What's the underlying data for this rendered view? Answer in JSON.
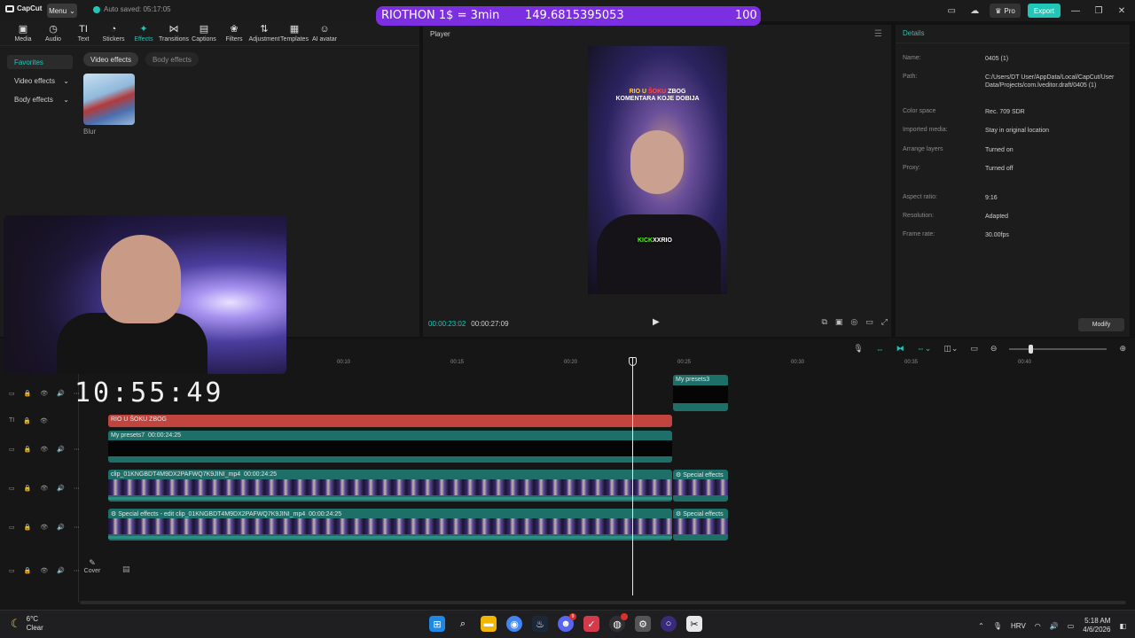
{
  "titlebar": {
    "app_name": "CapCut",
    "menu_label": "Menu",
    "autosave": "Auto saved: 05:17:05",
    "pro_label": "Pro",
    "export_label": "Export"
  },
  "banner": {
    "left": "RIOTHON 1$ = 3min",
    "middle": "149.6815395053",
    "right": "100"
  },
  "toolbar": [
    {
      "label": "Media",
      "icon": "▣"
    },
    {
      "label": "Audio",
      "icon": "◷"
    },
    {
      "label": "Text",
      "icon": "TI"
    },
    {
      "label": "Stickers",
      "icon": "◔"
    },
    {
      "label": "Effects",
      "icon": "✦"
    },
    {
      "label": "Transitions",
      "icon": "⋈"
    },
    {
      "label": "Captions",
      "icon": "▤"
    },
    {
      "label": "Filters",
      "icon": "❀"
    },
    {
      "label": "Adjustment",
      "icon": "⇅"
    },
    {
      "label": "Templates",
      "icon": "▦"
    },
    {
      "label": "AI avatar",
      "icon": "☺"
    }
  ],
  "side_nav": {
    "favorites": "Favorites",
    "video_effects": "Video effects",
    "body_effects": "Body effects"
  },
  "effect_tabs": {
    "video": "Video effects",
    "body": "Body effects"
  },
  "effect_card": {
    "label": "Blur"
  },
  "player": {
    "title": "Player",
    "caption_line1_a": "RIO U",
    "caption_line1_b": "ŠOKU",
    "caption_line1_c": "ZBOG",
    "caption_line2": "KOMENTARA KOJE DOBIJA",
    "kick_a": "KICK",
    "kick_b": "XXRIO",
    "current_time": "00:00:23:02",
    "total_time": "00:00:27:09"
  },
  "details": {
    "title": "Details",
    "rows": [
      {
        "key": "Name:",
        "value": "0405 (1)"
      },
      {
        "key": "Path:",
        "value": "C:/Users/DT User/AppData/Local/CapCut/User Data/Projects/com.lveditor.draft/0405 (1)"
      },
      {
        "key": "Color space",
        "value": "Rec. 709 SDR"
      },
      {
        "key": "Imported media:",
        "value": "Stay in original location"
      },
      {
        "key": "Arrange layers",
        "value": "Turned on"
      },
      {
        "key": "Proxy:",
        "value": "Turned off"
      },
      {
        "key": "Aspect ratio:",
        "value": "9:16"
      },
      {
        "key": "Resolution:",
        "value": "Adapted"
      },
      {
        "key": "Frame rate:",
        "value": "30.00fps"
      }
    ],
    "modify_label": "Modify"
  },
  "timeline": {
    "clock": "10:55:49",
    "ruler": [
      "00:10",
      "00:15",
      "00:20",
      "00:25",
      "00:30",
      "00:35",
      "00:40"
    ],
    "clips": {
      "preset_right": "My presets3",
      "text_clip": "RIO U ŠOKU ZBOG",
      "preset_clip": "My presets7",
      "preset_duration": "00:00:24:25",
      "video_clip": "clip_01KNGBDT4M9DX2PAFWQ7K9JINI_mp4",
      "video_duration": "00:00:24:25",
      "video_fx": "Special effects",
      "fx_clip": "Special effects - edit  clip_01KNGBDT4M9DX2PAFWQ7K9JINI_mp4",
      "fx_duration": "00:00:24:25",
      "fx_right": "Special effects"
    },
    "cover_label": "Cover"
  },
  "taskbar": {
    "temp": "6°C",
    "condition": "Clear",
    "lang": "HRV",
    "time": "5:18 AM",
    "date": "4/6/2026",
    "apps": [
      "windows-start",
      "search",
      "file-explorer",
      "chrome",
      "steam",
      "discord",
      "twitch-tool",
      "obs",
      "settings",
      "circle-app",
      "capcut"
    ]
  }
}
